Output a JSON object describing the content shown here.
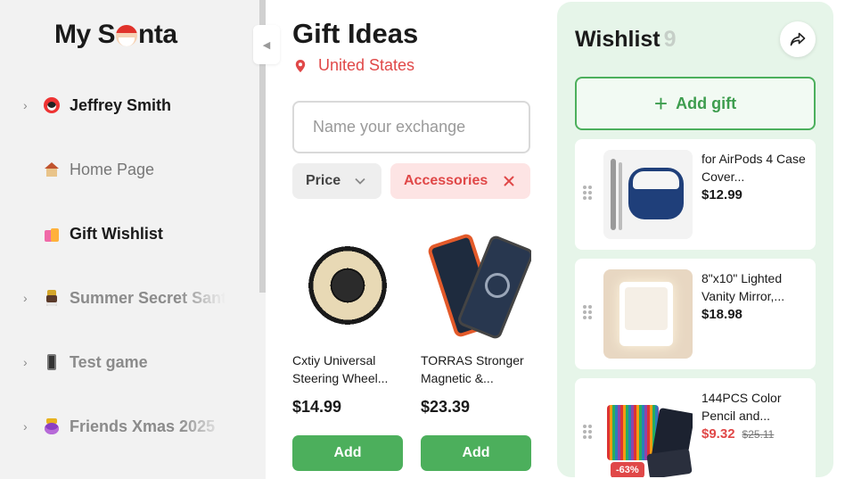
{
  "sidebar": {
    "logo_prefix": "My S",
    "logo_suffix": "nta",
    "items": [
      {
        "label": "Jeffrey Smith",
        "icon": "penguin-icon",
        "style": "bold",
        "has_chevron": true
      },
      {
        "label": "Home Page",
        "icon": "house-icon",
        "style": "regular",
        "has_chevron": false
      },
      {
        "label": "Gift Wishlist",
        "icon": "shopping-bags-icon",
        "style": "bold",
        "has_chevron": false
      },
      {
        "label": "Summer Secret Santa",
        "icon": "santa-icon",
        "style": "muted",
        "has_chevron": true
      },
      {
        "label": "Test game",
        "icon": "phone-icon",
        "style": "muted",
        "has_chevron": true
      },
      {
        "label": "Friends Xmas 2025",
        "icon": "mage-icon",
        "style": "muted",
        "has_chevron": true
      }
    ]
  },
  "main": {
    "title": "Gift Ideas",
    "location": "United States",
    "search": {
      "placeholder": "Name your exchange",
      "value": ""
    },
    "filters": {
      "price": "Price",
      "accessories": "Accessories"
    },
    "products": [
      {
        "name": "Cxtiy Universal Steering Wheel...",
        "price": "$14.99",
        "button": "Add"
      },
      {
        "name": "TORRAS Stronger Magnetic &...",
        "price": "$23.39",
        "button": "Add"
      }
    ]
  },
  "wishlist": {
    "title": "Wishlist",
    "count": "9",
    "add_label": "Add gift",
    "items": [
      {
        "name": "for AirPods 4 Case Cover...",
        "price": "$12.99"
      },
      {
        "name": "8\"x10\" Lighted Vanity Mirror,...",
        "price": "$18.98"
      },
      {
        "name": "144PCS Color Pencil and...",
        "price": "$9.32",
        "original_price": "$25.11",
        "discount": "-63%"
      }
    ]
  },
  "colors": {
    "accent_green": "#4caf5c",
    "accent_red": "#e04848",
    "wishlist_bg": "#e6f5e9",
    "sidebar_bg": "#f2f2f2"
  }
}
